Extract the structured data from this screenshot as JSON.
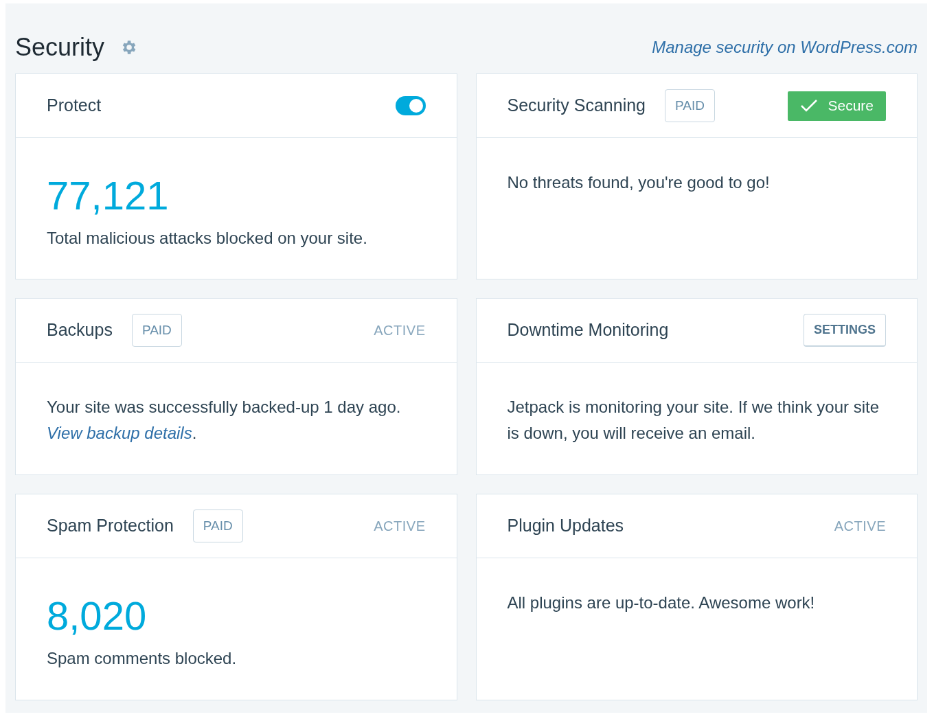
{
  "section": {
    "title": "Security",
    "link": "Manage security on WordPress.com"
  },
  "cards": [
    {
      "title": "Protect",
      "header": {
        "kind": "toggle",
        "on": true
      },
      "body": {
        "kind": "stat",
        "value": "77,121",
        "caption": "Total malicious attacks blocked on your site."
      }
    },
    {
      "title": "Security Scanning",
      "badge": "PAID",
      "header": {
        "kind": "status",
        "label": "Secure"
      },
      "body": {
        "kind": "text",
        "text": "No threats found, you're good to go!"
      }
    },
    {
      "title": "Backups",
      "badge": "PAID",
      "header": {
        "kind": "active",
        "label": "ACTIVE"
      },
      "body": {
        "kind": "text",
        "text": "Your site was successfully backed-up 1 day ago. ",
        "link": "View backup details",
        "after": "."
      }
    },
    {
      "title": "Downtime Monitoring",
      "header": {
        "kind": "button",
        "label": "SETTINGS"
      },
      "body": {
        "kind": "text",
        "text": "Jetpack is monitoring your site. If we think your site is down, you will receive an email."
      }
    },
    {
      "title": "Spam Protection",
      "badge": "PAID",
      "header": {
        "kind": "active",
        "label": "ACTIVE"
      },
      "body": {
        "kind": "stat",
        "value": "8,020",
        "caption": "Spam comments blocked."
      }
    },
    {
      "title": "Plugin Updates",
      "header": {
        "kind": "active",
        "label": "ACTIVE"
      },
      "body": {
        "kind": "text",
        "text": "All plugins are up-to-date. Awesome work!"
      }
    }
  ]
}
